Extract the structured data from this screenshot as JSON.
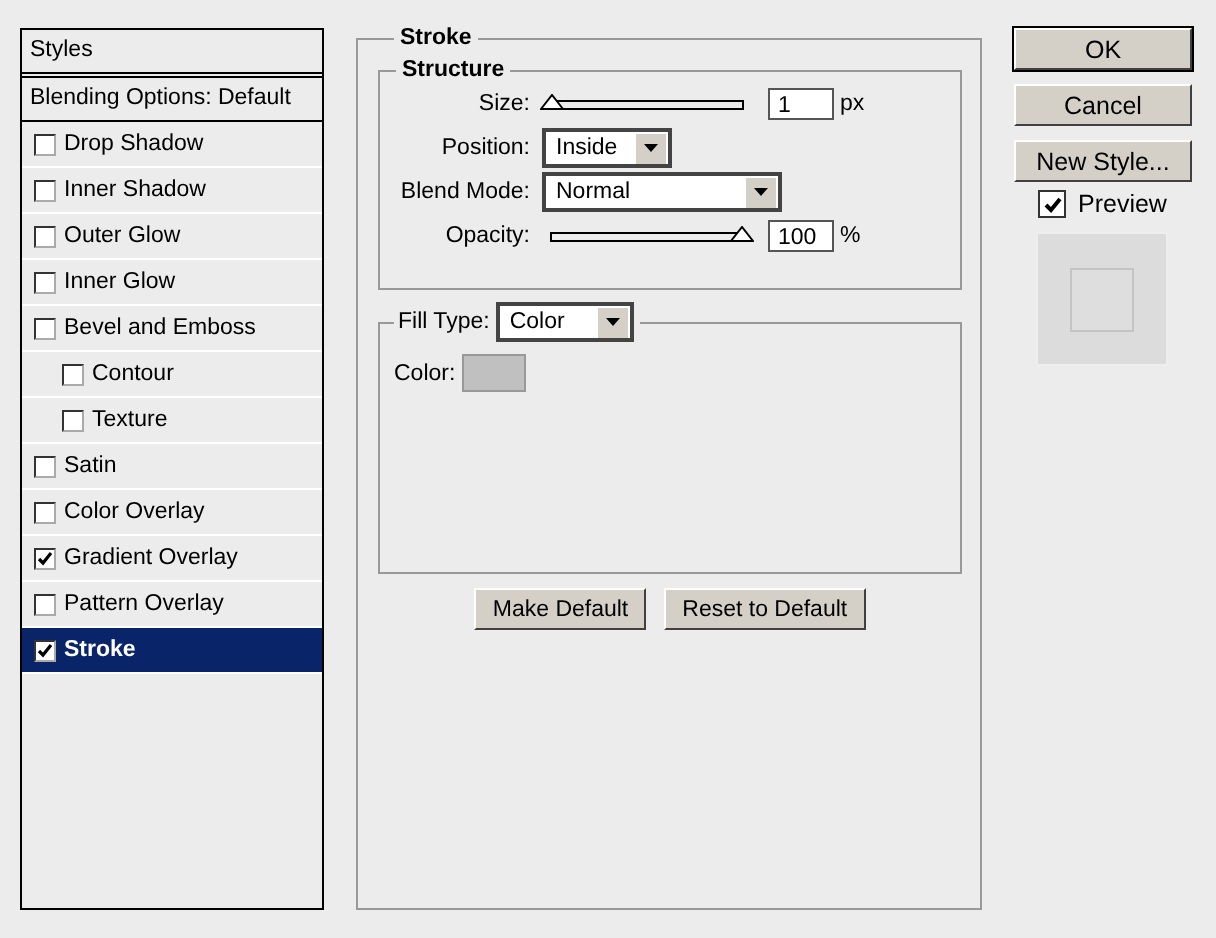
{
  "styles_panel": {
    "header": "Styles",
    "blending_options": "Blending Options: Default",
    "items": [
      {
        "label": "Drop Shadow",
        "checked": false,
        "selected": false
      },
      {
        "label": "Inner Shadow",
        "checked": false,
        "selected": false
      },
      {
        "label": "Outer Glow",
        "checked": false,
        "selected": false
      },
      {
        "label": "Inner Glow",
        "checked": false,
        "selected": false
      },
      {
        "label": "Bevel and Emboss",
        "checked": false,
        "selected": false,
        "children": [
          {
            "label": "Contour",
            "checked": false,
            "selected": false
          },
          {
            "label": "Texture",
            "checked": false,
            "selected": false
          }
        ]
      },
      {
        "label": "Satin",
        "checked": false,
        "selected": false
      },
      {
        "label": "Color Overlay",
        "checked": false,
        "selected": false
      },
      {
        "label": "Gradient Overlay",
        "checked": true,
        "selected": false
      },
      {
        "label": "Pattern Overlay",
        "checked": false,
        "selected": false
      },
      {
        "label": "Stroke",
        "checked": true,
        "selected": true
      }
    ]
  },
  "stroke": {
    "title": "Stroke",
    "structure": {
      "title": "Structure",
      "size": {
        "label": "Size:",
        "level": 0,
        "value": "1",
        "unit": "px"
      },
      "position": {
        "label": "Position:",
        "value": "Inside"
      },
      "blend_mode": {
        "label": "Blend Mode:",
        "value": "Normal"
      },
      "opacity": {
        "label": "Opacity:",
        "level": 1,
        "value": "100",
        "unit": "%"
      }
    },
    "fill": {
      "label": "Fill Type:",
      "value": "Color",
      "color_label": "Color:",
      "color": "#c0c0c0"
    },
    "buttons": [
      "Make Default",
      "Reset to Default"
    ]
  },
  "buttons": [
    "OK",
    "Cancel",
    "New Style..."
  ],
  "preview": {
    "label": "Preview",
    "checked": true
  }
}
